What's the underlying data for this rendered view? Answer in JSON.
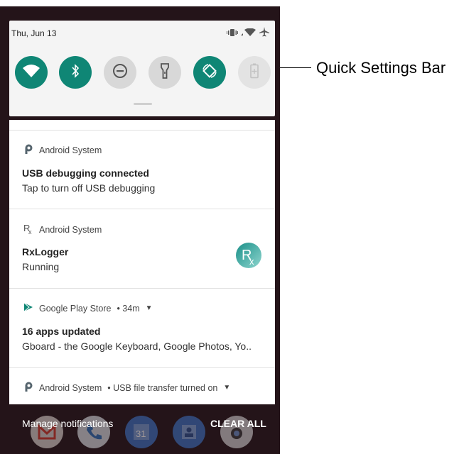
{
  "quick_settings": {
    "date": "Thu, Jun 13",
    "status_icons": [
      "vibrate-icon",
      "wifi-icon",
      "airplane-icon"
    ],
    "tiles": [
      {
        "name": "wifi",
        "icon": "wifi-icon",
        "state": "on"
      },
      {
        "name": "bluetooth",
        "icon": "bluetooth-icon",
        "state": "on"
      },
      {
        "name": "do-not-disturb",
        "icon": "do-not-disturb-icon",
        "state": "off"
      },
      {
        "name": "flashlight",
        "icon": "flashlight-icon",
        "state": "off"
      },
      {
        "name": "auto-rotate",
        "icon": "auto-rotate-icon",
        "state": "on"
      },
      {
        "name": "battery-saver",
        "icon": "battery-saver-icon",
        "state": "disabled"
      }
    ],
    "accent_color": "#0f8675"
  },
  "notifications": [
    {
      "app": "Android System",
      "icon": "android-system-icon",
      "title": "USB debugging connected",
      "text": "Tap to turn off USB debugging"
    },
    {
      "app": "Android System",
      "icon": "rx-icon",
      "title": "RxLogger",
      "text": "Running",
      "large_icon": "rxlogger-app-icon"
    },
    {
      "app": "Google Play Store",
      "meta": "• 34m",
      "icon": "play-store-icon",
      "title": "16 apps updated",
      "text": "Gboard - the Google Keyboard, Google Photos, Yo.."
    },
    {
      "app": "Android System",
      "meta": "• USB file transfer turned on",
      "icon": "android-system-icon"
    }
  ],
  "footer": {
    "manage_label": "Manage notifications",
    "clear_label": "CLEAR ALL"
  },
  "dock_icons": [
    "gmail-icon",
    "phone-icon",
    "calendar-icon",
    "contacts-icon",
    "camera-icon"
  ],
  "callout": {
    "label": "Quick Settings Bar"
  }
}
